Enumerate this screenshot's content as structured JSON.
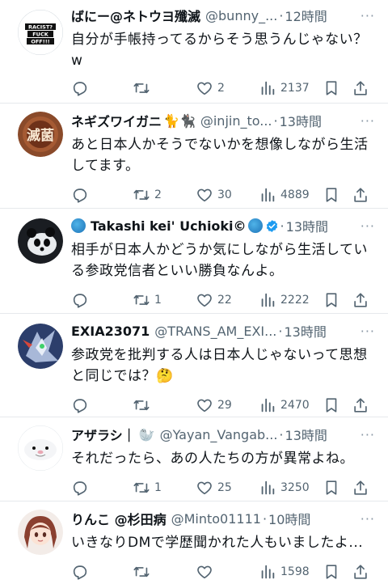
{
  "tweets": [
    {
      "name": "ばにー@ネトウヨ殲滅",
      "handle": "@bunny_...",
      "dot": "·",
      "time": "12時間",
      "body": "自分が手帳持ってるからそう思うんじゃない？ w",
      "avatar_icon": "racist-fuck-off-avatar",
      "avatar_text_1": "RACIST?",
      "avatar_text_2": "FUCK",
      "avatar_text_3": "OFF!!!",
      "reply_count": "",
      "retweet_count": "",
      "like_count": "2",
      "view_count": "2137"
    },
    {
      "name": "ネギズワイガニ",
      "name_emoji": "🐈🐈‍⬛",
      "handle": "@injin_to...",
      "dot": "·",
      "time": "13時間",
      "body": "あと日本人かそうでないかを想像しながら生活してます。",
      "avatar_icon": "metsukin-avatar",
      "avatar_text_1": "滅菌",
      "reply_count": "",
      "retweet_count": "2",
      "like_count": "30",
      "view_count": "4889"
    },
    {
      "name": "Takashi kei' Uchioki©",
      "handle": "",
      "dot": "·",
      "time": "13時間",
      "body": "相手が日本人かどうか気にしながら生活している参政党信者といい勝負なんよ。",
      "avatar_icon": "panda-avatar",
      "reply_count": "",
      "retweet_count": "1",
      "like_count": "22",
      "view_count": "2222"
    },
    {
      "name": "EXIA23071",
      "handle": "@TRANS_AM_EXI...",
      "dot": "·",
      "time": "13時間",
      "body": "参政党を批判する人は日本人じゃないって思想と同じでは？",
      "body_emoji": "🤔",
      "avatar_icon": "gundam-avatar",
      "reply_count": "",
      "retweet_count": "",
      "like_count": "29",
      "view_count": "2470"
    },
    {
      "name": "アザラシ｜",
      "name_emoji": "🦭",
      "handle": "@Yayan_Vangab...",
      "dot": "·",
      "time": "13時間",
      "body": "それだったら、あの人たちの方が異常よね。",
      "avatar_icon": "seal-avatar",
      "reply_count": "",
      "retweet_count": "1",
      "like_count": "25",
      "view_count": "3250"
    },
    {
      "name": "りんこ @杉田病",
      "handle": "@Minto01111",
      "dot": "·",
      "time": "10時間",
      "body": "いきなりDMで学歴聞かれた人もいましたよ...",
      "avatar_icon": "anime-girl-avatar",
      "reply_count": "",
      "retweet_count": "",
      "like_count": "",
      "view_count": "1598"
    }
  ],
  "more_label": "···",
  "colors": {
    "text": "#0f1419",
    "secondary": "#536471",
    "divider": "#e6e9ec",
    "verified": "#1d9bf0"
  }
}
